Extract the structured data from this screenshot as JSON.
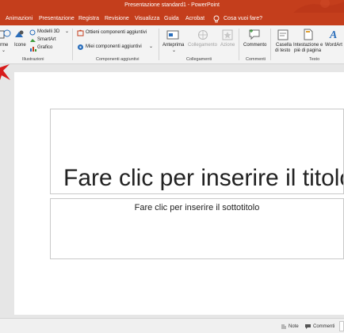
{
  "window": {
    "title": "Presentazione standard1  -  PowerPoint"
  },
  "tabs": [
    {
      "label": "Animazioni"
    },
    {
      "label": "Presentazione"
    },
    {
      "label": "Registra"
    },
    {
      "label": "Revisione"
    },
    {
      "label": "Visualizza"
    },
    {
      "label": "Guida"
    },
    {
      "label": "Acrobat"
    }
  ],
  "tell_me": {
    "label": "Cosa vuoi fare?"
  },
  "ribbon": {
    "illustrazioni": {
      "label": "Illustrazioni",
      "forme": "rme",
      "icone": "Icone",
      "modelli3d": "Modelli 3D",
      "smartart": "SmartArt",
      "grafico": "Grafico"
    },
    "componenti": {
      "label": "Componenti aggiuntivi",
      "ottieni": "Ottieni componenti aggiuntivi",
      "miei": "Miei componenti aggiuntivi"
    },
    "collegamenti": {
      "label": "Collegamenti",
      "anteprima": "Anteprima",
      "collegamento": "Collegamento",
      "azione": "Azione"
    },
    "commenti": {
      "label": "Commenti",
      "commento": "Commento"
    },
    "testo": {
      "label": "Testo",
      "casella_1": "Casella",
      "casella_2": "di testo",
      "intestazione_1": "Intestazione e",
      "intestazione_2": "piè di pagina",
      "wordart": "WordArt"
    }
  },
  "slide": {
    "title_placeholder": "Fare clic per inserire il titolo",
    "subtitle_placeholder": "Fare clic per inserire il sottotitolo"
  },
  "status": {
    "note": "Note",
    "commenti": "Commenti"
  },
  "colors": {
    "accent": "#c43e1c",
    "ribbon_bg": "#f3f3f3",
    "canvas_bg": "#e6e6e6"
  }
}
